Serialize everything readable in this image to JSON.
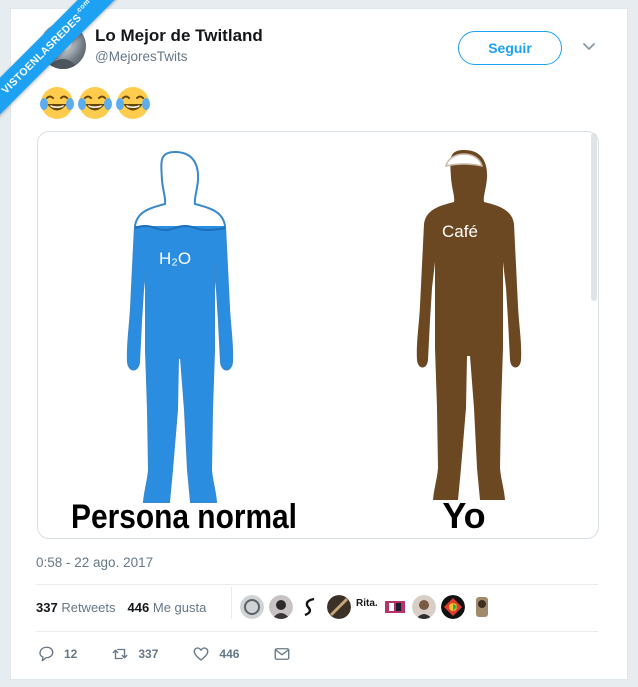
{
  "watermark": {
    "text": "VISTOENLASREDES",
    "suffix": ".com"
  },
  "account": {
    "name": "Lo Mejor de Twitland",
    "handle": "@MejoresTwits"
  },
  "follow_label": "Seguir",
  "tweet_emojis": [
    "face-with-tears-of-joy",
    "face-with-tears-of-joy",
    "face-with-tears-of-joy"
  ],
  "image": {
    "left_label": "H₂O",
    "right_label": "Café",
    "left_caption": "Persona normal",
    "right_caption": "Yo"
  },
  "timestamp": "0:58 - 22 ago. 2017",
  "stats": {
    "retweets_count": "337",
    "retweets_label": "Retweets",
    "likes_count": "446",
    "likes_label": "Me gusta"
  },
  "likers_text": "Rita.",
  "actions": {
    "replies": "12",
    "retweets": "337",
    "likes": "446"
  },
  "colors": {
    "accent": "#1da1f2",
    "water": "#2a8de0",
    "coffee": "#6b4722",
    "secondary_text": "#657786"
  }
}
